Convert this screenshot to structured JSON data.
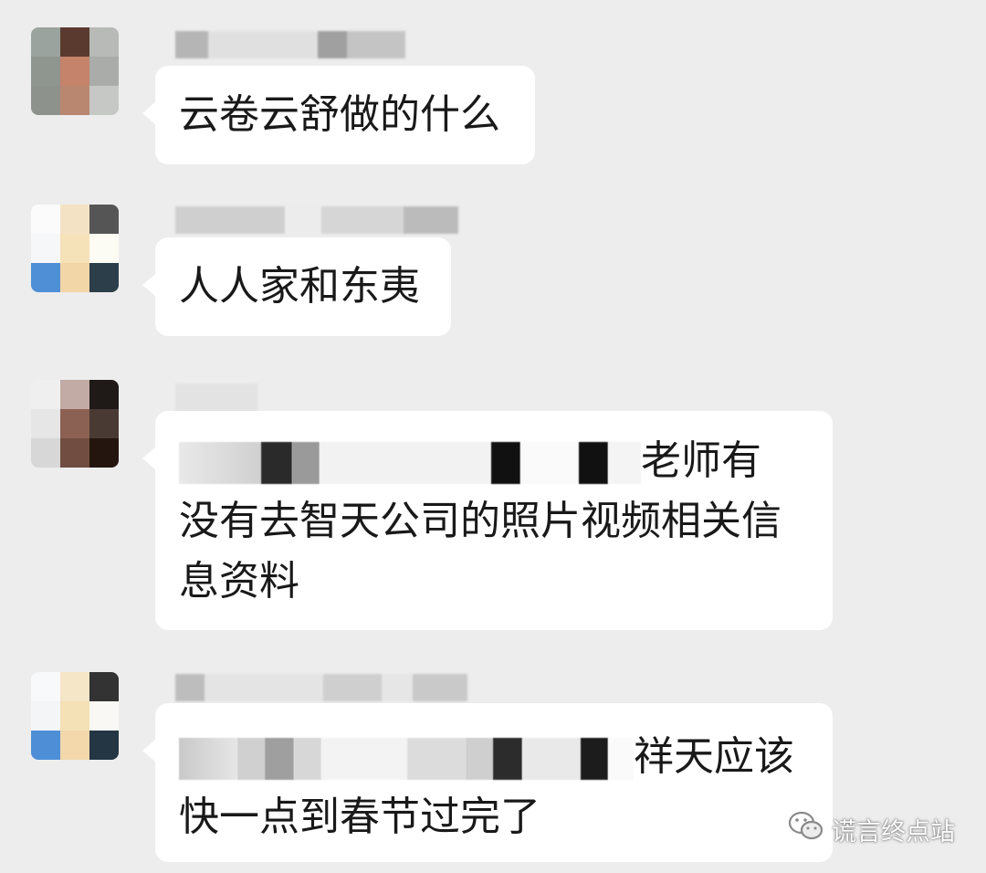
{
  "messages": [
    {
      "avatar_alt": "avatar",
      "lines": [
        "云卷云舒做的什么"
      ]
    },
    {
      "avatar_alt": "avatar",
      "lines": [
        "人人家和东夷"
      ]
    },
    {
      "avatar_alt": "avatar",
      "lines": [
        "老师有",
        "没有去智天公司的照片视频相关信",
        "息资料"
      ]
    },
    {
      "avatar_alt": "avatar",
      "lines": [
        "祥天应该",
        "快一点到春节过完了"
      ]
    }
  ],
  "watermark": {
    "text": "谎言终点站",
    "icon": "wechat-logo-icon"
  },
  "colors": {
    "background": "#ededed",
    "bubble": "#ffffff",
    "text": "#191919"
  }
}
